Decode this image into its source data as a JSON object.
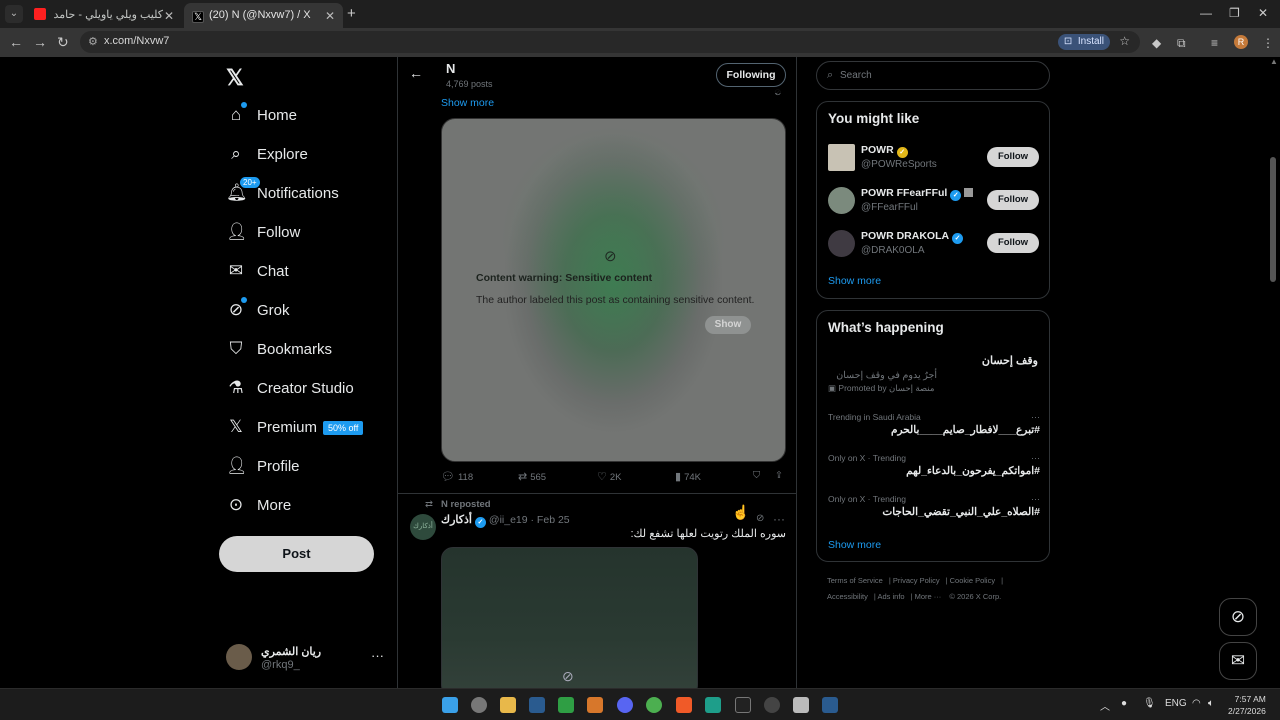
{
  "browser": {
    "tabs": [
      {
        "title": "كليب ويلي ياويلي - حامد الضبعا",
        "active": false
      },
      {
        "title": "(20) N (@Nxvw7) / X",
        "active": true
      }
    ],
    "url": "x.com/Nxvw7",
    "install_label": "Install",
    "profile_initial": "R"
  },
  "nav": {
    "items": [
      {
        "label": "Home",
        "icon": "home-icon"
      },
      {
        "label": "Explore",
        "icon": "search-icon"
      },
      {
        "label": "Notifications",
        "icon": "bell-icon",
        "badge": "20+"
      },
      {
        "label": "Follow",
        "icon": "person-add-icon"
      },
      {
        "label": "Chat",
        "icon": "mail-icon"
      },
      {
        "label": "Grok",
        "icon": "grok-icon"
      },
      {
        "label": "Bookmarks",
        "icon": "bookmark-icon"
      },
      {
        "label": "Creator Studio",
        "icon": "flask-icon"
      },
      {
        "label": "Premium",
        "icon": "x-logo-icon",
        "badge": "50% off"
      },
      {
        "label": "Profile",
        "icon": "person-icon"
      },
      {
        "label": "More",
        "icon": "more-circle-icon"
      }
    ],
    "post_label": "Post",
    "account": {
      "name": "ريان الشمري",
      "handle": "@rkq9_"
    }
  },
  "profile_header": {
    "name": "N",
    "posts": "4,769 posts",
    "following_label": "Following"
  },
  "post1": {
    "show_more": "Show more",
    "warning_title": "Content warning: Sensitive content",
    "warning_text": "The author labeled this post as containing sensitive content.",
    "show_label": "Show",
    "replies": "118",
    "reposts": "565",
    "likes": "2K",
    "views": "74K"
  },
  "post2": {
    "repost_label": "N reposted",
    "avatar_text": "أذكارك",
    "name": "أذكارك",
    "handle": "@ii_e19 · Feb 25",
    "text": "سوره الملك رتويت لعلها تشفع لك:"
  },
  "sidebar": {
    "search_placeholder": "Search",
    "you_might_like_title": "You might like",
    "suggestions": [
      {
        "name": "POWR",
        "handle": "@POWReSports",
        "follow_label": "Follow",
        "badge": "gold"
      },
      {
        "name": "POWR FFearFFul",
        "handle": "@FFearFFul",
        "follow_label": "Follow",
        "badge": "blue"
      },
      {
        "name": "POWR DRAKOLA",
        "handle": "@DRAK0OLA",
        "follow_label": "Follow",
        "badge": "blue"
      }
    ],
    "show_more": "Show more",
    "happening_title": "What’s happening",
    "promo": {
      "title": "وقف إحسان",
      "subtitle": "أجرٌ يدوم في وقف إحسان",
      "promoted_by": "Promoted by منصة إحسان"
    },
    "trends": [
      {
        "meta": "Trending in Saudi Arabia",
        "title": "#تبرع___لافطار_صايم____بالحرم"
      },
      {
        "meta": "Only on X · Trending",
        "title": "#امواتكم_يفرحون_بالدعاء_لهم"
      },
      {
        "meta": "Only on X · Trending",
        "title": "#الصلاه_علي_النبي_تقضي_الحاجات"
      }
    ],
    "show_more_2": "Show more",
    "footer": [
      "Terms of Service",
      "Privacy Policy",
      "Cookie Policy",
      "Accessibility",
      "Ads info",
      "More ···",
      "© 2026 X Corp."
    ]
  },
  "taskbar": {
    "lang": "ENG",
    "time": "7:57 AM",
    "date": "2/27/2026"
  },
  "colors": {
    "accent": "#1d9bf0",
    "background": "#000000",
    "border": "#2f3336"
  }
}
